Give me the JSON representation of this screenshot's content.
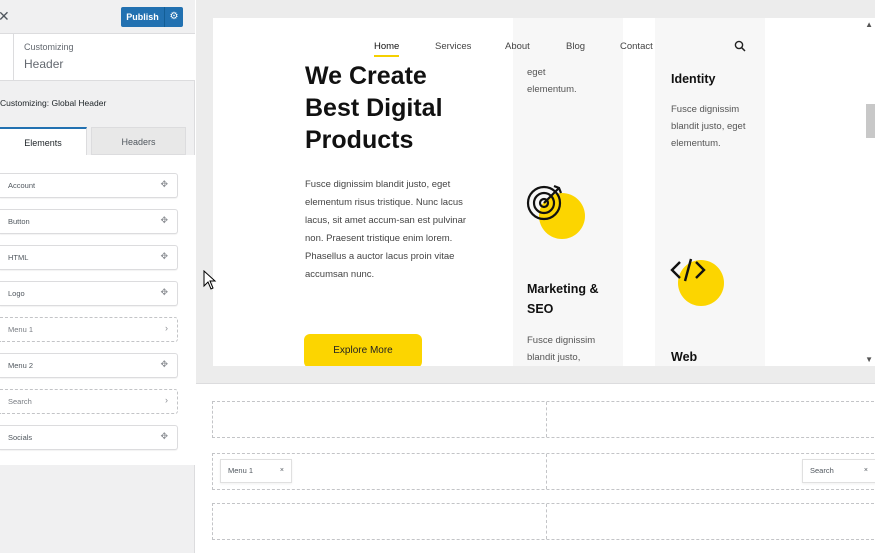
{
  "topbar": {
    "close_icon": "close-icon",
    "publish_label": "Publish",
    "settings_icon": "gear-icon"
  },
  "section": {
    "customizing_label": "Customizing",
    "title": "Header"
  },
  "panel": {
    "heading": "Customizing: Global Header"
  },
  "tabs": [
    {
      "label": "Elements",
      "active": true
    },
    {
      "label": "Headers",
      "active": false
    }
  ],
  "elements": [
    {
      "label": "Account",
      "icon": "move-icon"
    },
    {
      "label": "Button",
      "icon": "move-icon"
    },
    {
      "label": "HTML",
      "icon": "move-icon"
    },
    {
      "label": "Logo",
      "icon": "move-icon"
    },
    {
      "label": "Menu 1",
      "icon": "chevron-right-icon"
    },
    {
      "label": "Menu 2",
      "icon": "move-icon"
    },
    {
      "label": "Search",
      "icon": "chevron-right-icon"
    },
    {
      "label": "Socials",
      "icon": "move-icon"
    }
  ],
  "site": {
    "nav": [
      "Home",
      "Services",
      "About",
      "Blog",
      "Contact"
    ],
    "active_nav": "Home",
    "hero_title": "We Create Best Digital Products",
    "hero_text": "Fusce dignissim blandit justo, eget elementum risus tristique. Nunc lacus lacus, sit amet accum-san est pulvinar non. Praesent tristique enim lorem. Phasellus a auctor lacus proin vitae accumsan nunc.",
    "cta_label": "Explore More",
    "card1_top_text": "eget elementum.",
    "card1_title": "Marketing & SEO",
    "card1_text": "Fusce dignissim blandit justo,",
    "card2_title_top": "Identity",
    "card2_text": "Fusce dignissim blandit justo, eget elementum.",
    "card2_title": "Web",
    "accent_color": "#fcd500"
  },
  "builder": {
    "rows": [
      {
        "chips": []
      },
      {
        "chips": [
          {
            "label": "Menu 1",
            "side": "left"
          },
          {
            "label": "Search",
            "side": "right"
          }
        ]
      },
      {
        "chips": []
      }
    ],
    "chip_remove": "×"
  }
}
